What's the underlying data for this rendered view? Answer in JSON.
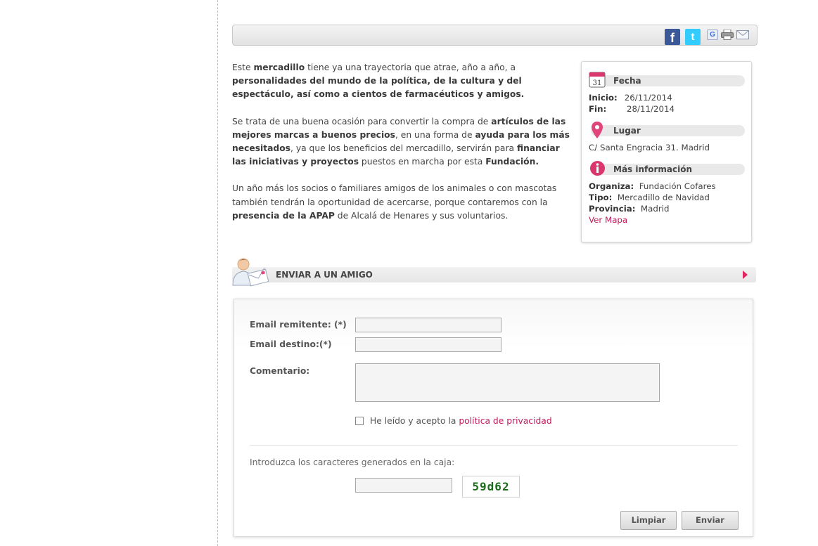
{
  "share": {
    "facebook": "f",
    "twitter": "t",
    "google": "G"
  },
  "article": {
    "p1": [
      {
        "t": "Este ",
        "b": false
      },
      {
        "t": "mercadillo",
        "b": true
      },
      {
        "t": " tiene ya una trayectoria que atrae, año a año, a ",
        "b": false
      },
      {
        "t": "personalidades del mundo de la política, de la cultura y del espectáculo, así como a cientos de farmacéuticos y amigos.",
        "b": true
      }
    ],
    "p2": [
      {
        "t": "Se trata de una buena ocasión para convertir la compra de ",
        "b": false
      },
      {
        "t": "artículos de las mejores marcas a buenos precios",
        "b": true
      },
      {
        "t": ", en una forma de ",
        "b": false
      },
      {
        "t": "ayuda para los más necesitados",
        "b": true
      },
      {
        "t": ", ya que los beneficios del mercadillo, servirán para ",
        "b": false
      },
      {
        "t": "financiar las iniciativas y proyectos",
        "b": true
      },
      {
        "t": " puestos en marcha por esta ",
        "b": false
      },
      {
        "t": "Fundación.",
        "b": true
      }
    ],
    "p3": [
      {
        "t": "Un año más los socios o familiares amigos de los animales o con mascotas también tendrán la oportunidad de acercarse, porque contaremos con la ",
        "b": false
      },
      {
        "t": "presencia de la APAP",
        "b": true
      },
      {
        "t": " de Alcalá de Henares y sus voluntarios.",
        "b": false
      }
    ]
  },
  "info": {
    "fecha_title": "Fecha",
    "calendar_day": "31",
    "inicio_label": "Inicio:",
    "inicio_value": "26/11/2014",
    "fin_label": "Fin:",
    "fin_value": "28/11/2014",
    "lugar_title": "Lugar",
    "lugar_value": "C/ Santa Engracia 31. Madrid",
    "mas_title": "Más información",
    "organiza_label": "Organiza:",
    "organiza_value": "Fundación Cofares",
    "tipo_label": "Tipo:",
    "tipo_value": "Mercadillo de Navidad",
    "provincia_label": "Provincia:",
    "provincia_value": "Madrid",
    "ver_mapa": "Ver Mapa"
  },
  "section": {
    "title": "ENVIAR A UN AMIGO"
  },
  "form": {
    "email_remitente_label": "Email remitente: (*)",
    "email_remitente_value": "",
    "email_destino_label": "Email destino:(*)",
    "email_destino_value": "",
    "comentario_label": "Comentario:",
    "comentario_value": "",
    "privacy_text": "He leído y acepto la ",
    "privacy_link": "política de privacidad",
    "captcha_prompt": "Introduzca los caracteres generados en la caja:",
    "captcha_value": "",
    "captcha_code": "59d62",
    "clear_label": "Limpiar",
    "send_label": "Enviar"
  },
  "colors": {
    "accent": "#c2185b",
    "arrow": "#e0245e",
    "captcha": "#1a6b1a"
  }
}
